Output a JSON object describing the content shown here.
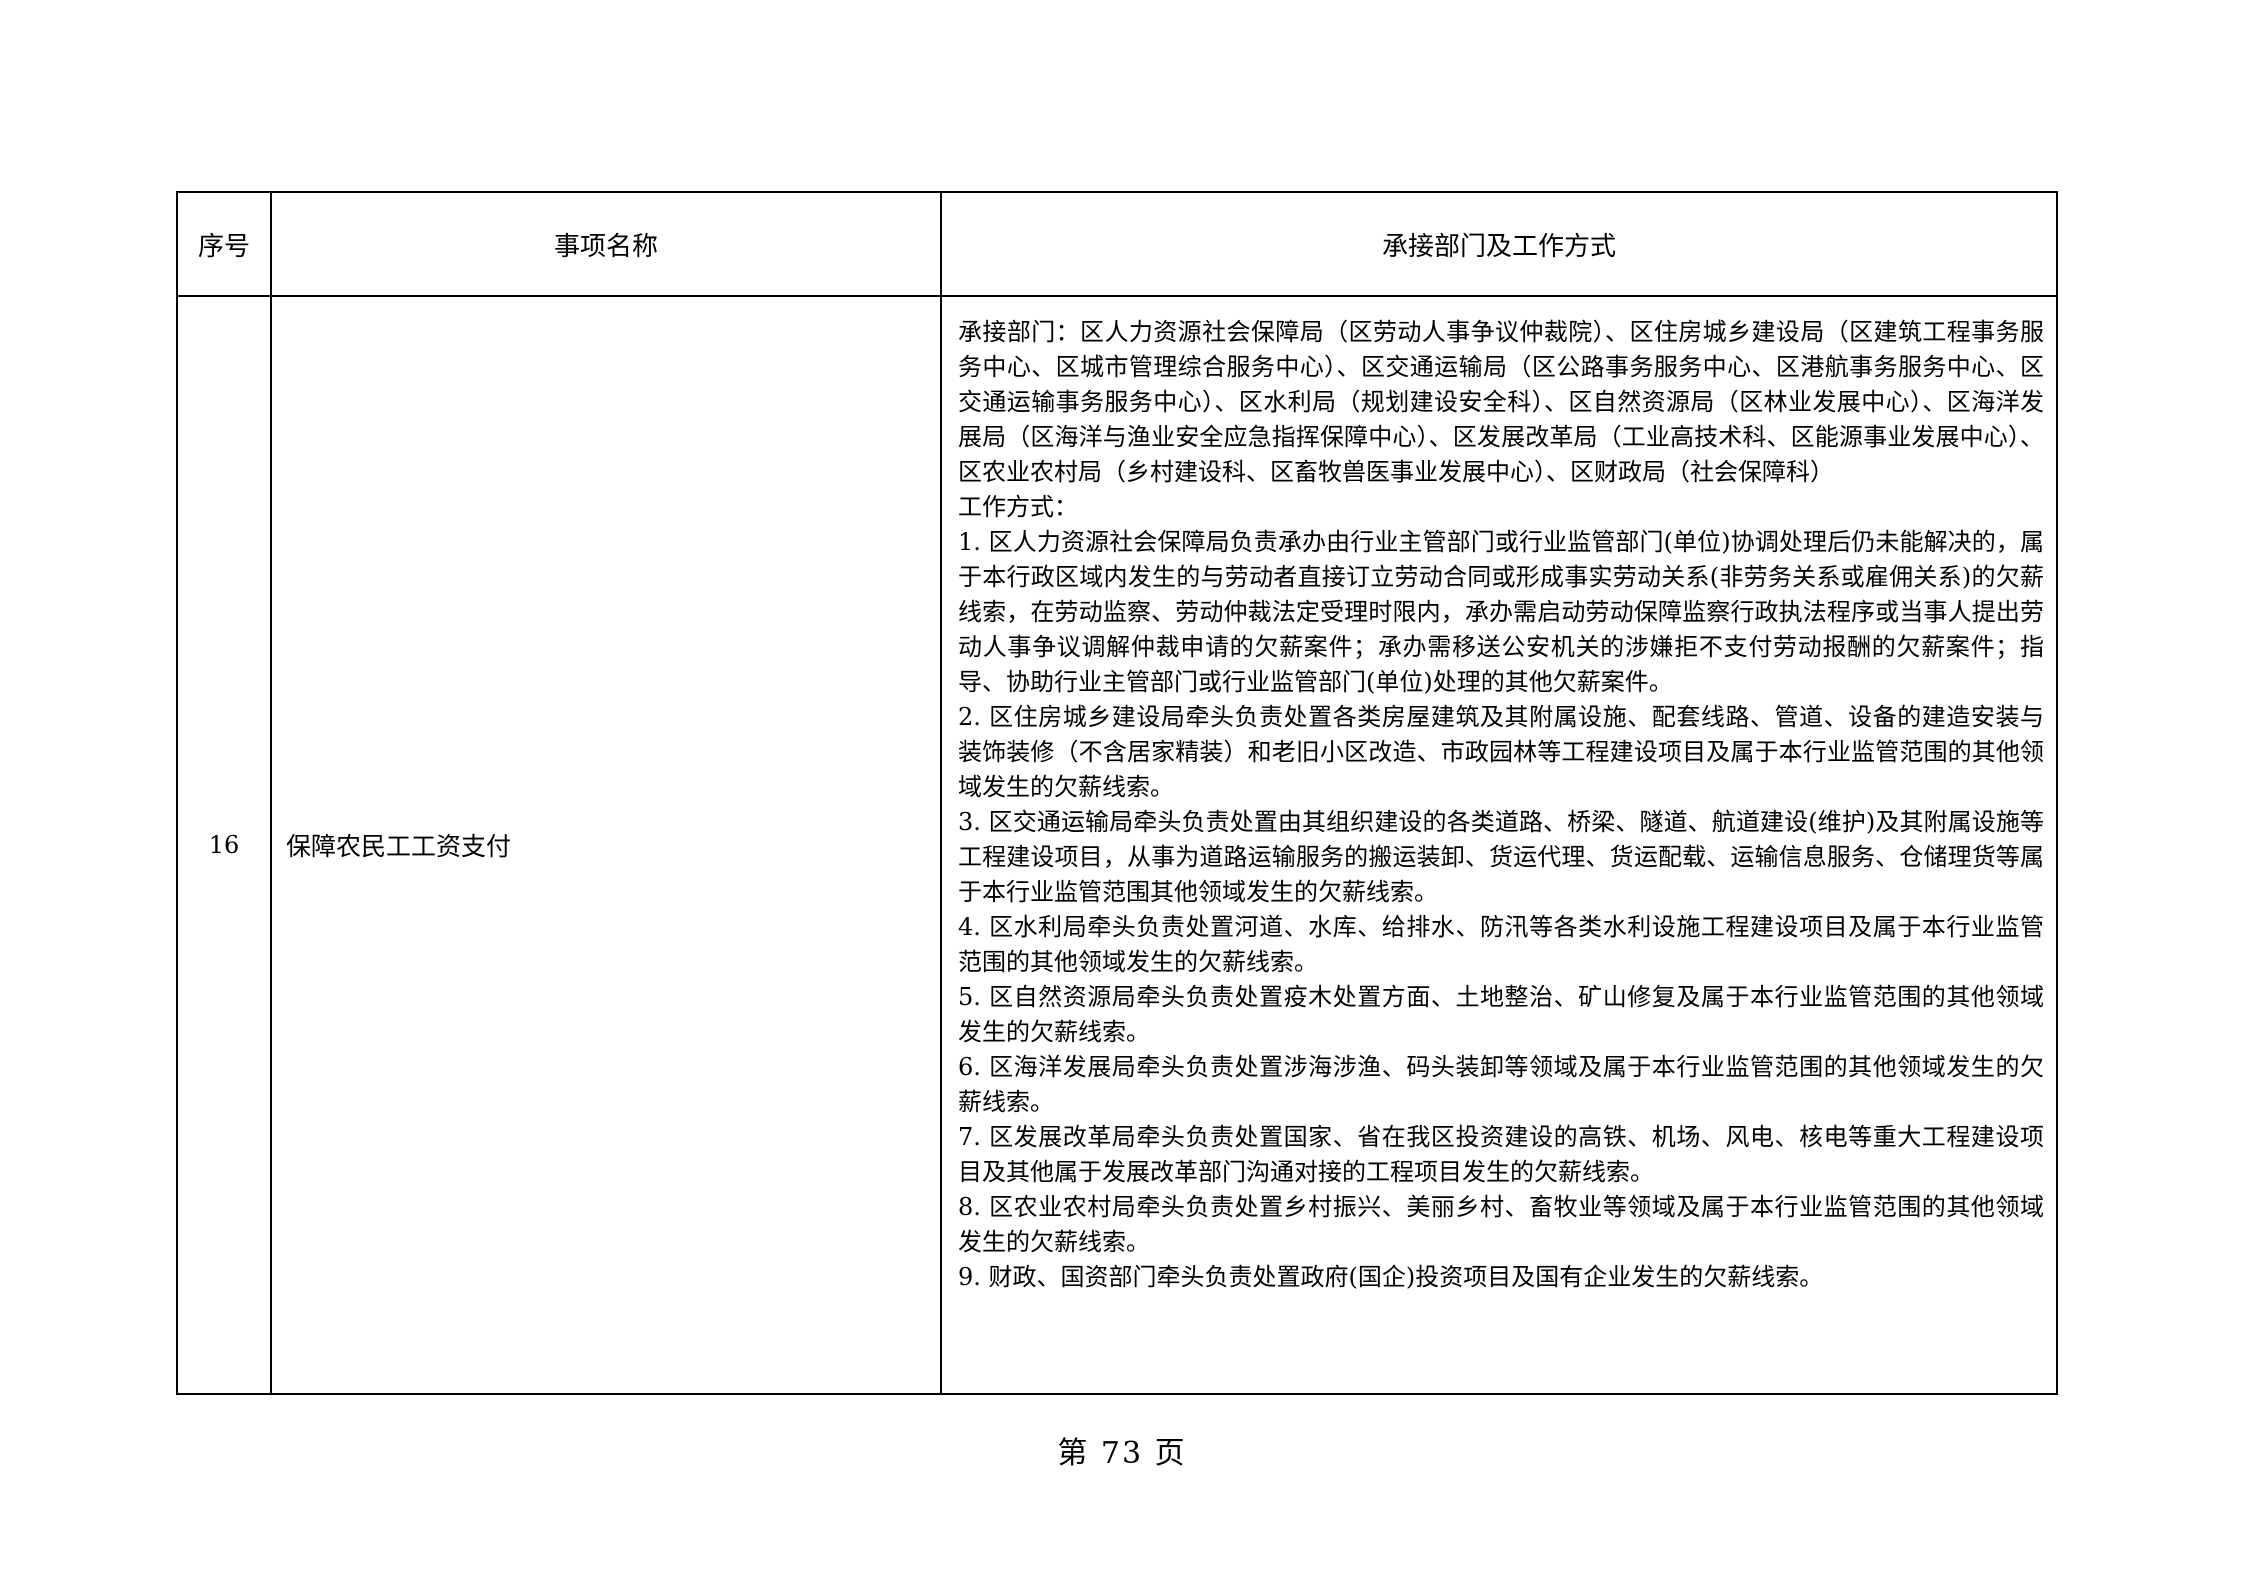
{
  "table": {
    "headers": {
      "no": "序号",
      "name": "事项名称",
      "dept": "承接部门及工作方式"
    },
    "rows": [
      {
        "no": "16",
        "name": "保障农民工工资支付",
        "dept_lines": [
          "承接部门：区人力资源社会保障局（区劳动人事争议仲裁院）、区住房城乡建设局（区建筑工程事务服务中心、区城市管理综合服务中心）、区交通运输局（区公路事务服务中心、区港航事务服务中心、区交通运输事务服务中心）、区水利局（规划建设安全科）、区自然资源局（区林业发展中心）、区海洋发展局（区海洋与渔业安全应急指挥保障中心）、区发展改革局（工业高技术科、区能源事业发展中心）、区农业农村局（乡村建设科、区畜牧兽医事业发展中心）、区财政局（社会保障科）",
          "工作方式：",
          "1. 区人力资源社会保障局负责承办由行业主管部门或行业监管部门(单位)协调处理后仍未能解决的，属于本行政区域内发生的与劳动者直接订立劳动合同或形成事实劳动关系(非劳务关系或雇佣关系)的欠薪线索，在劳动监察、劳动仲裁法定受理时限内，承办需启动劳动保障监察行政执法程序或当事人提出劳动人事争议调解仲裁申请的欠薪案件；承办需移送公安机关的涉嫌拒不支付劳动报酬的欠薪案件；指导、协助行业主管部门或行业监管部门(单位)处理的其他欠薪案件。",
          "2. 区住房城乡建设局牵头负责处置各类房屋建筑及其附属设施、配套线路、管道、设备的建造安装与装饰装修（不含居家精装）和老旧小区改造、市政园林等工程建设项目及属于本行业监管范围的其他领域发生的欠薪线索。",
          "3. 区交通运输局牵头负责处置由其组织建设的各类道路、桥梁、隧道、航道建设(维护)及其附属设施等工程建设项目，从事为道路运输服务的搬运装卸、货运代理、货运配载、运输信息服务、仓储理货等属于本行业监管范围其他领域发生的欠薪线索。",
          "4. 区水利局牵头负责处置河道、水库、给排水、防汛等各类水利设施工程建设项目及属于本行业监管范围的其他领域发生的欠薪线索。",
          "5. 区自然资源局牵头负责处置疫木处置方面、土地整治、矿山修复及属于本行业监管范围的其他领域发生的欠薪线索。",
          "6. 区海洋发展局牵头负责处置涉海涉渔、码头装卸等领域及属于本行业监管范围的其他领域发生的欠薪线索。",
          "7. 区发展改革局牵头负责处置国家、省在我区投资建设的高铁、机场、风电、核电等重大工程建设项目及其他属于发展改革部门沟通对接的工程项目发生的欠薪线索。",
          "8. 区农业农村局牵头负责处置乡村振兴、美丽乡村、畜牧业等领域及属于本行业监管范围的其他领域发生的欠薪线索。",
          "9. 财政、国资部门牵头负责处置政府(国企)投资项目及国有企业发生的欠薪线索。"
        ]
      }
    ]
  },
  "footer": {
    "page_label": "第 73 页"
  }
}
